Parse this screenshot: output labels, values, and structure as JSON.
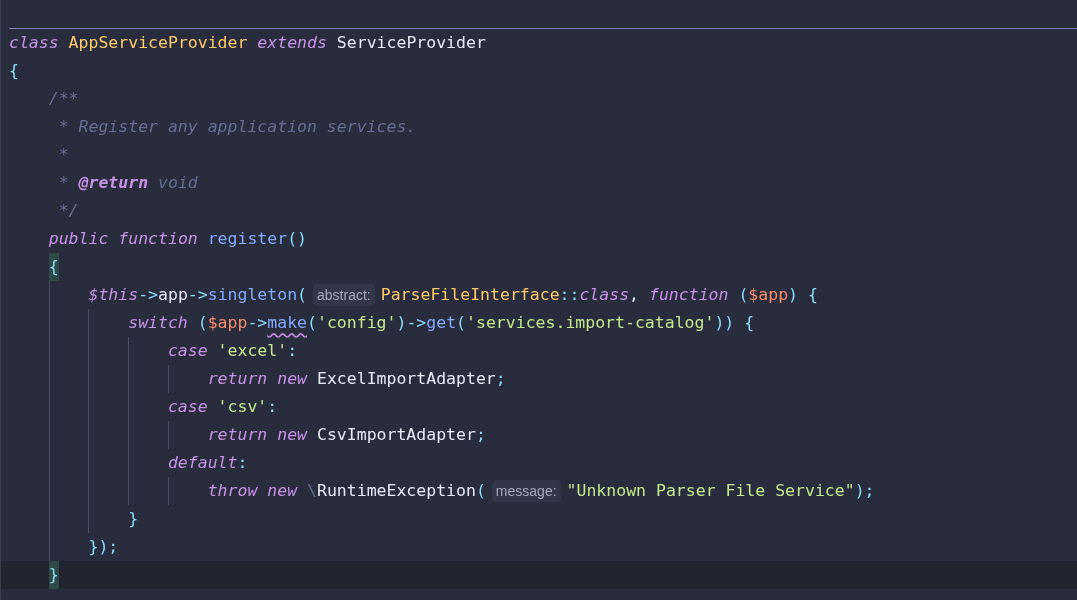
{
  "editor": {
    "lines": [
      {
        "tokens": [
          {
            "text": "class",
            "kind": "kw"
          },
          {
            "text": " AppServiceProvider",
            "kind": "type"
          },
          {
            "text": " extends",
            "kind": "kw"
          },
          {
            "text": " ServiceProvider",
            "kind": "plain"
          }
        ]
      },
      {
        "tokens": [
          {
            "text": "{",
            "kind": "punct"
          }
        ],
        "children": [
          {
            "kind": "doc",
            "tokens": [
              {
                "text": "/**",
                "kind": "comment"
              }
            ]
          },
          {
            "kind": "doc-cont",
            "tokens": [
              {
                "text": "* Register any application services.",
                "kind": "comment"
              }
            ]
          },
          {
            "kind": "doc-cont",
            "tokens": [
              {
                "text": "*",
                "kind": "comment"
              }
            ]
          },
          {
            "kind": "doc-cont",
            "tokens": [
              {
                "text": "* ",
                "kind": "comment"
              },
              {
                "text": "@return",
                "kind": "doctag"
              },
              {
                "text": " void",
                "kind": "comment"
              }
            ]
          },
          {
            "kind": "doc-cont",
            "tokens": [
              {
                "text": "*/",
                "kind": "comment"
              }
            ]
          },
          {
            "tokens": [
              {
                "text": "public",
                "kind": "kw"
              },
              {
                "text": " function",
                "kind": "kw"
              },
              {
                "text": " register",
                "kind": "method"
              },
              {
                "text": "()",
                "kind": "punct"
              }
            ]
          },
          {
            "tokens": [
              {
                "text": "{",
                "kind": "punct",
                "matched": true
              }
            ],
            "children": [
              {
                "tokens": [
                  {
                    "text": "$this",
                    "kind": "this"
                  },
                  {
                    "text": "->",
                    "kind": "punct"
                  },
                  {
                    "text": "app",
                    "kind": "plain"
                  },
                  {
                    "text": "->",
                    "kind": "punct"
                  },
                  {
                    "text": "singleton",
                    "kind": "method"
                  },
                  {
                    "text": "(",
                    "kind": "punct"
                  },
                  {
                    "text": "abstract:",
                    "kind": "hint"
                  },
                  {
                    "text": "ParseFileInterface",
                    "kind": "type"
                  },
                  {
                    "text": "::",
                    "kind": "punct"
                  },
                  {
                    "text": "class",
                    "kind": "kw"
                  },
                  {
                    "text": ", ",
                    "kind": "plain"
                  },
                  {
                    "text": "function",
                    "kind": "kw"
                  },
                  {
                    "text": " (",
                    "kind": "punct"
                  },
                  {
                    "text": "$app",
                    "kind": "var"
                  },
                  {
                    "text": ") {",
                    "kind": "punct"
                  }
                ],
                "children": [
                  {
                    "tokens": [
                      {
                        "text": "switch",
                        "kind": "kw"
                      },
                      {
                        "text": " (",
                        "kind": "punct"
                      },
                      {
                        "text": "$app",
                        "kind": "var"
                      },
                      {
                        "text": "->",
                        "kind": "punct"
                      },
                      {
                        "text": "make",
                        "kind": "method",
                        "warning": true
                      },
                      {
                        "text": "(",
                        "kind": "punct"
                      },
                      {
                        "text": "'config'",
                        "kind": "str"
                      },
                      {
                        "text": ")->",
                        "kind": "punct"
                      },
                      {
                        "text": "get",
                        "kind": "method"
                      },
                      {
                        "text": "(",
                        "kind": "punct"
                      },
                      {
                        "text": "'services.import-catalog'",
                        "kind": "str"
                      },
                      {
                        "text": ")) {",
                        "kind": "punct"
                      }
                    ],
                    "children": [
                      {
                        "tokens": [
                          {
                            "text": "case",
                            "kind": "kw"
                          },
                          {
                            "text": " 'excel'",
                            "kind": "str"
                          },
                          {
                            "text": ":",
                            "kind": "punct"
                          }
                        ],
                        "children": [
                          {
                            "tokens": [
                              {
                                "text": "return",
                                "kind": "kw"
                              },
                              {
                                "text": " new",
                                "kind": "kw"
                              },
                              {
                                "text": " ExcelImportAdapter",
                                "kind": "plain"
                              },
                              {
                                "text": ";",
                                "kind": "punct"
                              }
                            ]
                          }
                        ]
                      },
                      {
                        "tokens": [
                          {
                            "text": "case",
                            "kind": "kw"
                          },
                          {
                            "text": " 'csv'",
                            "kind": "str"
                          },
                          {
                            "text": ":",
                            "kind": "punct"
                          }
                        ],
                        "children": [
                          {
                            "tokens": [
                              {
                                "text": "return",
                                "kind": "kw"
                              },
                              {
                                "text": " new",
                                "kind": "kw"
                              },
                              {
                                "text": " CsvImportAdapter",
                                "kind": "plain"
                              },
                              {
                                "text": ";",
                                "kind": "punct"
                              }
                            ]
                          }
                        ]
                      },
                      {
                        "tokens": [
                          {
                            "text": "default",
                            "kind": "kw"
                          },
                          {
                            "text": ":",
                            "kind": "punct"
                          }
                        ],
                        "children": [
                          {
                            "tokens": [
                              {
                                "text": "throw",
                                "kind": "kw"
                              },
                              {
                                "text": " new",
                                "kind": "kw"
                              },
                              {
                                "text": " \\",
                                "kind": "ns"
                              },
                              {
                                "text": "RuntimeException",
                                "kind": "plain"
                              },
                              {
                                "text": "(",
                                "kind": "punct"
                              },
                              {
                                "text": "message:",
                                "kind": "hint"
                              },
                              {
                                "text": "\"Unknown Parser File Service\"",
                                "kind": "str"
                              },
                              {
                                "text": ");",
                                "kind": "punct"
                              }
                            ]
                          }
                        ]
                      }
                    ]
                  },
                  {
                    "tokens": [
                      {
                        "text": "}",
                        "kind": "punct"
                      }
                    ]
                  }
                ]
              },
              {
                "tokens": [
                  {
                    "text": "});",
                    "kind": "punct"
                  }
                ]
              }
            ]
          },
          {
            "current": true,
            "tokens": [
              {
                "text": "}",
                "kind": "punct",
                "matched": true
              }
            ]
          }
        ]
      }
    ]
  }
}
